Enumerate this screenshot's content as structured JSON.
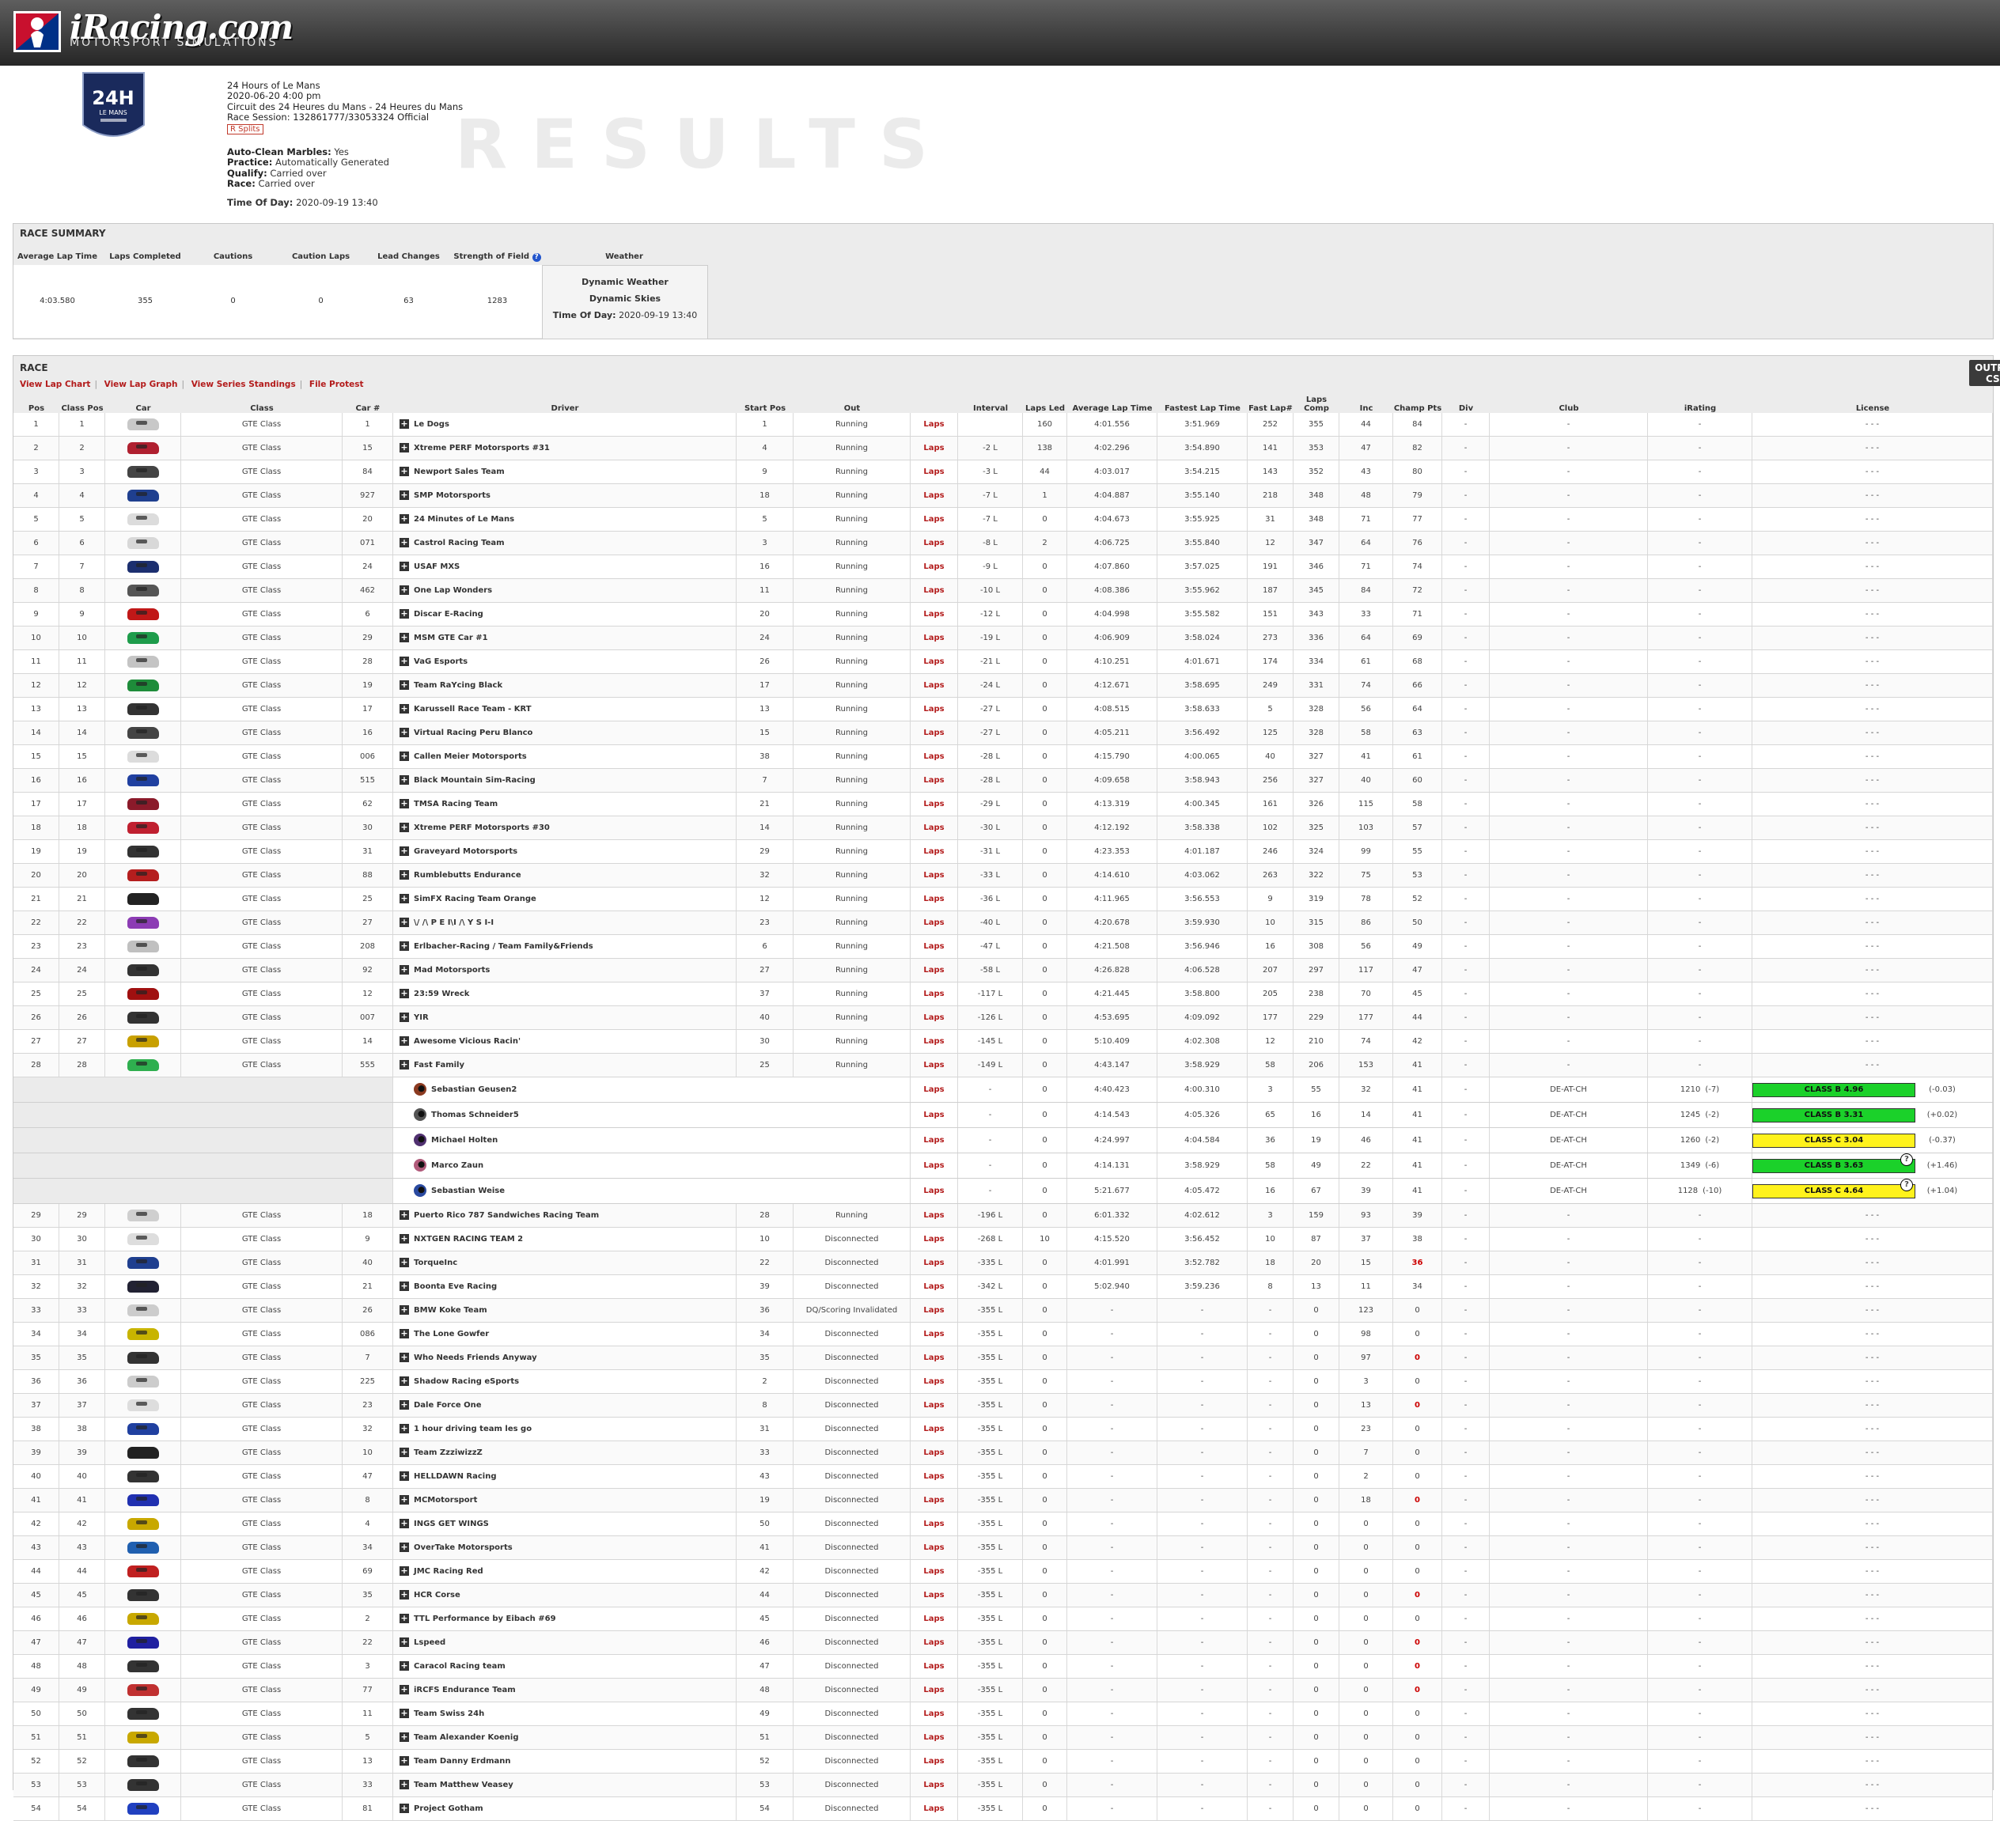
{
  "header": {
    "logo_text": "iRacing.com",
    "logo_sub": "MOTORSPORT SIMULATIONS"
  },
  "badge": {
    "main": "24H",
    "sub": "LE MANS"
  },
  "event": {
    "title": "24 Hours of Le Mans",
    "datetime": "2020-06-20 4:00 pm",
    "track": "Circuit des 24 Heures du Mans - 24 Heures du Mans",
    "session": "Race Session: 132861777/33053324 Official",
    "splits": "R Splits"
  },
  "conditions": {
    "marbles_label": "Auto-Clean Marbles:",
    "marbles": "Yes",
    "practice_label": "Practice:",
    "practice": "Automatically Generated",
    "qualify_label": "Qualify:",
    "qualify": "Carried over",
    "race_label": "Race:",
    "race": "Carried over",
    "tod_label": "Time Of Day:",
    "tod": "2020-09-19 13:40"
  },
  "results_word": "RESULTS",
  "summary": {
    "title": "RACE SUMMARY",
    "headers": [
      "Average Lap Time",
      "Laps Completed",
      "Cautions",
      "Caution Laps",
      "Lead Changes",
      "Strength of Field",
      "Weather"
    ],
    "values": [
      "4:03.580",
      "355",
      "0",
      "0",
      "63",
      "1283"
    ],
    "weather1": "Dynamic Weather",
    "weather2": "Dynamic Skies",
    "weather_tod_label": "Time Of Day:",
    "weather_tod": "2020-09-19 13:40"
  },
  "race": {
    "title": "RACE",
    "links": [
      "View Lap Chart",
      "View Lap Graph",
      "View Series Standings",
      "File Protest"
    ],
    "csv": "OUTPUT CSV",
    "headers": [
      "Pos",
      "Class Pos",
      "Car",
      "Class",
      "Car #",
      "Driver",
      "Start Pos",
      "Out",
      "",
      "Interval",
      "Laps Led",
      "Average Lap Time",
      "Fastest Lap Time",
      "Fast Lap#",
      "Laps Comp",
      "Inc",
      "Champ Pts",
      "Div",
      "Club",
      "iRating",
      "License"
    ],
    "class_name": "GTE Class",
    "laps_link": "Laps",
    "rows": [
      [
        "1",
        "1",
        "1",
        "Le Dogs",
        "1",
        "Running",
        "",
        "160",
        "4:01.556",
        "3:51.969",
        "252",
        "355",
        "44",
        "84"
      ],
      [
        "2",
        "2",
        "15",
        "Xtreme PERF Motorsports #31",
        "4",
        "Running",
        "-2 L",
        "138",
        "4:02.296",
        "3:54.890",
        "141",
        "353",
        "47",
        "82"
      ],
      [
        "3",
        "3",
        "84",
        "Newport Sales Team",
        "9",
        "Running",
        "-3 L",
        "44",
        "4:03.017",
        "3:54.215",
        "143",
        "352",
        "43",
        "80"
      ],
      [
        "4",
        "4",
        "927",
        "SMP Motorsports",
        "18",
        "Running",
        "-7 L",
        "1",
        "4:04.887",
        "3:55.140",
        "218",
        "348",
        "48",
        "79"
      ],
      [
        "5",
        "5",
        "20",
        "24 Minutes of Le Mans",
        "5",
        "Running",
        "-7 L",
        "0",
        "4:04.673",
        "3:55.925",
        "31",
        "348",
        "71",
        "77"
      ],
      [
        "6",
        "6",
        "071",
        "Castrol Racing Team",
        "3",
        "Running",
        "-8 L",
        "2",
        "4:06.725",
        "3:55.840",
        "12",
        "347",
        "64",
        "76"
      ],
      [
        "7",
        "7",
        "24",
        "USAF MXS",
        "16",
        "Running",
        "-9 L",
        "0",
        "4:07.860",
        "3:57.025",
        "191",
        "346",
        "71",
        "74"
      ],
      [
        "8",
        "8",
        "462",
        "One Lap Wonders",
        "11",
        "Running",
        "-10 L",
        "0",
        "4:08.386",
        "3:55.962",
        "187",
        "345",
        "84",
        "72"
      ],
      [
        "9",
        "9",
        "6",
        "Discar E-Racing",
        "20",
        "Running",
        "-12 L",
        "0",
        "4:04.998",
        "3:55.582",
        "151",
        "343",
        "33",
        "71"
      ],
      [
        "10",
        "10",
        "29",
        "MSM GTE Car #1",
        "24",
        "Running",
        "-19 L",
        "0",
        "4:06.909",
        "3:58.024",
        "273",
        "336",
        "64",
        "69"
      ],
      [
        "11",
        "11",
        "28",
        "VaG Esports",
        "26",
        "Running",
        "-21 L",
        "0",
        "4:10.251",
        "4:01.671",
        "174",
        "334",
        "61",
        "68"
      ],
      [
        "12",
        "12",
        "19",
        "Team RaYcing Black",
        "17",
        "Running",
        "-24 L",
        "0",
        "4:12.671",
        "3:58.695",
        "249",
        "331",
        "74",
        "66"
      ],
      [
        "13",
        "13",
        "17",
        "Karussell Race Team - KRT",
        "13",
        "Running",
        "-27 L",
        "0",
        "4:08.515",
        "3:58.633",
        "5",
        "328",
        "56",
        "64"
      ],
      [
        "14",
        "14",
        "16",
        "Virtual Racing Peru Blanco",
        "15",
        "Running",
        "-27 L",
        "0",
        "4:05.211",
        "3:56.492",
        "125",
        "328",
        "58",
        "63"
      ],
      [
        "15",
        "15",
        "006",
        "Callen Meier Motorsports",
        "38",
        "Running",
        "-28 L",
        "0",
        "4:15.790",
        "4:00.065",
        "40",
        "327",
        "41",
        "61"
      ],
      [
        "16",
        "16",
        "515",
        "Black Mountain Sim-Racing",
        "7",
        "Running",
        "-28 L",
        "0",
        "4:09.658",
        "3:58.943",
        "256",
        "327",
        "40",
        "60"
      ],
      [
        "17",
        "17",
        "62",
        "TMSA Racing Team",
        "21",
        "Running",
        "-29 L",
        "0",
        "4:13.319",
        "4:00.345",
        "161",
        "326",
        "115",
        "58"
      ],
      [
        "18",
        "18",
        "30",
        "Xtreme PERF Motorsports #30",
        "14",
        "Running",
        "-30 L",
        "0",
        "4:12.192",
        "3:58.338",
        "102",
        "325",
        "103",
        "57"
      ],
      [
        "19",
        "19",
        "31",
        "Graveyard Motorsports",
        "29",
        "Running",
        "-31 L",
        "0",
        "4:23.353",
        "4:01.187",
        "246",
        "324",
        "99",
        "55"
      ],
      [
        "20",
        "20",
        "88",
        "Rumblebutts Endurance",
        "32",
        "Running",
        "-33 L",
        "0",
        "4:14.610",
        "4:03.062",
        "263",
        "322",
        "75",
        "53"
      ],
      [
        "21",
        "21",
        "25",
        "SimFX Racing Team Orange",
        "12",
        "Running",
        "-36 L",
        "0",
        "4:11.965",
        "3:56.553",
        "9",
        "319",
        "78",
        "52"
      ],
      [
        "22",
        "22",
        "27",
        "\\/ /\\ P E I\\I /\\ Y S I-I",
        "23",
        "Running",
        "-40 L",
        "0",
        "4:20.678",
        "3:59.930",
        "10",
        "315",
        "86",
        "50"
      ],
      [
        "23",
        "23",
        "208",
        "Erlbacher-Racing / Team Family&Friends",
        "6",
        "Running",
        "-47 L",
        "0",
        "4:21.508",
        "3:56.946",
        "16",
        "308",
        "56",
        "49"
      ],
      [
        "24",
        "24",
        "92",
        "Mad Motorsports",
        "27",
        "Running",
        "-58 L",
        "0",
        "4:26.828",
        "4:06.528",
        "207",
        "297",
        "117",
        "47"
      ],
      [
        "25",
        "25",
        "12",
        "23:59 Wreck",
        "37",
        "Running",
        "-117 L",
        "0",
        "4:21.445",
        "3:58.800",
        "205",
        "238",
        "70",
        "45"
      ],
      [
        "26",
        "26",
        "007",
        "YIR",
        "40",
        "Running",
        "-126 L",
        "0",
        "4:53.695",
        "4:09.092",
        "177",
        "229",
        "177",
        "44"
      ],
      [
        "27",
        "27",
        "14",
        "Awesome Vicious Racin'",
        "30",
        "Running",
        "-145 L",
        "0",
        "5:10.409",
        "4:02.308",
        "12",
        "210",
        "74",
        "42"
      ],
      [
        "28",
        "28",
        "555",
        "Fast Family",
        "25",
        "Running",
        "-149 L",
        "0",
        "4:43.147",
        "3:58.929",
        "58",
        "206",
        "153",
        "41"
      ]
    ],
    "drivers": [
      [
        "Sebastian Geusen2",
        "-",
        "0",
        "4:40.423",
        "4:00.310",
        "3",
        "55",
        "32",
        "41",
        "DE-AT-CH",
        "1210",
        "(-7)",
        "CLASS B 4.96",
        "(-0.03)"
      ],
      [
        "Thomas Schneider5",
        "-",
        "0",
        "4:14.543",
        "4:05.326",
        "65",
        "16",
        "14",
        "41",
        "DE-AT-CH",
        "1245",
        "(-2)",
        "CLASS B 3.31",
        "(+0.02)"
      ],
      [
        "Michael Holten",
        "-",
        "0",
        "4:24.997",
        "4:04.584",
        "36",
        "19",
        "46",
        "41",
        "DE-AT-CH",
        "1260",
        "(-2)",
        "CLASS C 3.04",
        "(-0.37)"
      ],
      [
        "Marco Zaun",
        "-",
        "0",
        "4:14.131",
        "3:58.929",
        "58",
        "49",
        "22",
        "41",
        "DE-AT-CH",
        "1349",
        "(-6)",
        "CLASS B 3.63",
        "(+1.46)"
      ],
      [
        "Sebastian Weise",
        "-",
        "0",
        "5:21.677",
        "4:05.472",
        "16",
        "67",
        "39",
        "41",
        "DE-AT-CH",
        "1128",
        "(-10)",
        "CLASS C 4.64",
        "(+1.04)"
      ]
    ],
    "rows2": [
      [
        "29",
        "29",
        "18",
        "Puerto Rico 787 Sandwiches Racing Team",
        "28",
        "Running",
        "-196 L",
        "0",
        "6:01.332",
        "4:02.612",
        "3",
        "159",
        "93",
        "39"
      ],
      [
        "30",
        "30",
        "9",
        "NXTGEN RACING TEAM 2",
        "10",
        "Disconnected",
        "-268 L",
        "10",
        "4:15.520",
        "3:56.452",
        "10",
        "87",
        "37",
        "38"
      ],
      [
        "31",
        "31",
        "40",
        "TorqueInc",
        "22",
        "Disconnected",
        "-335 L",
        "0",
        "4:01.991",
        "3:52.782",
        "18",
        "20",
        "15",
        "36"
      ],
      [
        "32",
        "32",
        "21",
        "Boonta Eve Racing",
        "39",
        "Disconnected",
        "-342 L",
        "0",
        "5:02.940",
        "3:59.236",
        "8",
        "13",
        "11",
        "34"
      ],
      [
        "33",
        "33",
        "26",
        "BMW Koke Team",
        "36",
        "DQ/Scoring Invalidated",
        "-355 L",
        "0",
        "-",
        "-",
        "-",
        "0",
        "123",
        "0"
      ],
      [
        "34",
        "34",
        "086",
        "The Lone Gowfer",
        "34",
        "Disconnected",
        "-355 L",
        "0",
        "-",
        "-",
        "-",
        "0",
        "98",
        "0"
      ],
      [
        "35",
        "35",
        "7",
        "Who Needs Friends Anyway",
        "35",
        "Disconnected",
        "-355 L",
        "0",
        "-",
        "-",
        "-",
        "0",
        "97",
        "0"
      ],
      [
        "36",
        "36",
        "225",
        "Shadow Racing eSports",
        "2",
        "Disconnected",
        "-355 L",
        "0",
        "-",
        "-",
        "-",
        "0",
        "3",
        "0"
      ],
      [
        "37",
        "37",
        "23",
        "Dale Force One",
        "8",
        "Disconnected",
        "-355 L",
        "0",
        "-",
        "-",
        "-",
        "0",
        "13",
        "0"
      ],
      [
        "38",
        "38",
        "32",
        "1 hour driving team les go",
        "31",
        "Disconnected",
        "-355 L",
        "0",
        "-",
        "-",
        "-",
        "0",
        "23",
        "0"
      ],
      [
        "39",
        "39",
        "10",
        "Team ZzziwizzZ",
        "33",
        "Disconnected",
        "-355 L",
        "0",
        "-",
        "-",
        "-",
        "0",
        "7",
        "0"
      ],
      [
        "40",
        "40",
        "47",
        "HELLDAWN Racing",
        "43",
        "Disconnected",
        "-355 L",
        "0",
        "-",
        "-",
        "-",
        "0",
        "2",
        "0"
      ],
      [
        "41",
        "41",
        "8",
        "MCMotorsport",
        "19",
        "Disconnected",
        "-355 L",
        "0",
        "-",
        "-",
        "-",
        "0",
        "18",
        "0"
      ],
      [
        "42",
        "42",
        "4",
        "INGS GET WINGS",
        "50",
        "Disconnected",
        "-355 L",
        "0",
        "-",
        "-",
        "-",
        "0",
        "0",
        "0"
      ],
      [
        "43",
        "43",
        "34",
        "OverTake Motorsports",
        "41",
        "Disconnected",
        "-355 L",
        "0",
        "-",
        "-",
        "-",
        "0",
        "0",
        "0"
      ],
      [
        "44",
        "44",
        "69",
        "JMC Racing Red",
        "42",
        "Disconnected",
        "-355 L",
        "0",
        "-",
        "-",
        "-",
        "0",
        "0",
        "0"
      ],
      [
        "45",
        "45",
        "35",
        "HCR Corse",
        "44",
        "Disconnected",
        "-355 L",
        "0",
        "-",
        "-",
        "-",
        "0",
        "0",
        "0"
      ],
      [
        "46",
        "46",
        "2",
        "TTL Performance by Eibach #69",
        "45",
        "Disconnected",
        "-355 L",
        "0",
        "-",
        "-",
        "-",
        "0",
        "0",
        "0"
      ],
      [
        "47",
        "47",
        "22",
        "Lspeed",
        "46",
        "Disconnected",
        "-355 L",
        "0",
        "-",
        "-",
        "-",
        "0",
        "0",
        "0"
      ],
      [
        "48",
        "48",
        "3",
        "Caracol Racing team",
        "47",
        "Disconnected",
        "-355 L",
        "0",
        "-",
        "-",
        "-",
        "0",
        "0",
        "0"
      ],
      [
        "49",
        "49",
        "77",
        "iRCFS Endurance Team",
        "48",
        "Disconnected",
        "-355 L",
        "0",
        "-",
        "-",
        "-",
        "0",
        "0",
        "0"
      ],
      [
        "50",
        "50",
        "11",
        "Team Swiss 24h",
        "49",
        "Disconnected",
        "-355 L",
        "0",
        "-",
        "-",
        "-",
        "0",
        "0",
        "0"
      ],
      [
        "51",
        "51",
        "5",
        "Team Alexander Koenig",
        "51",
        "Disconnected",
        "-355 L",
        "0",
        "-",
        "-",
        "-",
        "0",
        "0",
        "0"
      ],
      [
        "52",
        "52",
        "13",
        "Team Danny Erdmann",
        "52",
        "Disconnected",
        "-355 L",
        "0",
        "-",
        "-",
        "-",
        "0",
        "0",
        "0"
      ],
      [
        "53",
        "53",
        "33",
        "Team Matthew Veasey",
        "53",
        "Disconnected",
        "-355 L",
        "0",
        "-",
        "-",
        "-",
        "0",
        "0",
        "0"
      ],
      [
        "54",
        "54",
        "81",
        "Project Gotham",
        "54",
        "Disconnected",
        "-355 L",
        "0",
        "-",
        "-",
        "-",
        "0",
        "0",
        "0"
      ]
    ],
    "empty": "-",
    "license_empty": "- - -",
    "champ_red": [
      "31",
      "35",
      "37",
      "41",
      "45",
      "47",
      "48",
      "49"
    ],
    "car_colors": [
      "#c8c8c8",
      "#b02030",
      "#444",
      "#1f3f8f",
      "#dcdcdc",
      "#d8d8d8",
      "#1c2f6f",
      "#555",
      "#c01818",
      "#1e9c4b",
      "#c4c4c4",
      "#1e8c3a",
      "#333",
      "#444",
      "#dcdcdc",
      "#2040a0",
      "#8b1a2a",
      "#c02030",
      "#333",
      "#b51e1e",
      "#222",
      "#8c3cb4",
      "#c0c0c0",
      "#333",
      "#a01010",
      "#333",
      "#c8a000",
      "#2faf4f",
      "#cfcfcf",
      "#ddd",
      "#1f3f8f",
      "#223",
      "#ccc",
      "#c8b400",
      "#333",
      "#ccc",
      "#ddd",
      "#2040a0",
      "#222",
      "#333",
      "#2030b0",
      "#c8a800",
      "#2060b0",
      "#c02020",
      "#333",
      "#c8a800",
      "#2020a0",
      "#333",
      "#c03030",
      "#333",
      "#c8a800",
      "#333",
      "#333",
      "#2040c0"
    ],
    "helmet_colors": [
      "#8b3a20",
      "#555",
      "#503070",
      "#b05a7a",
      "#2a4aa0"
    ]
  }
}
